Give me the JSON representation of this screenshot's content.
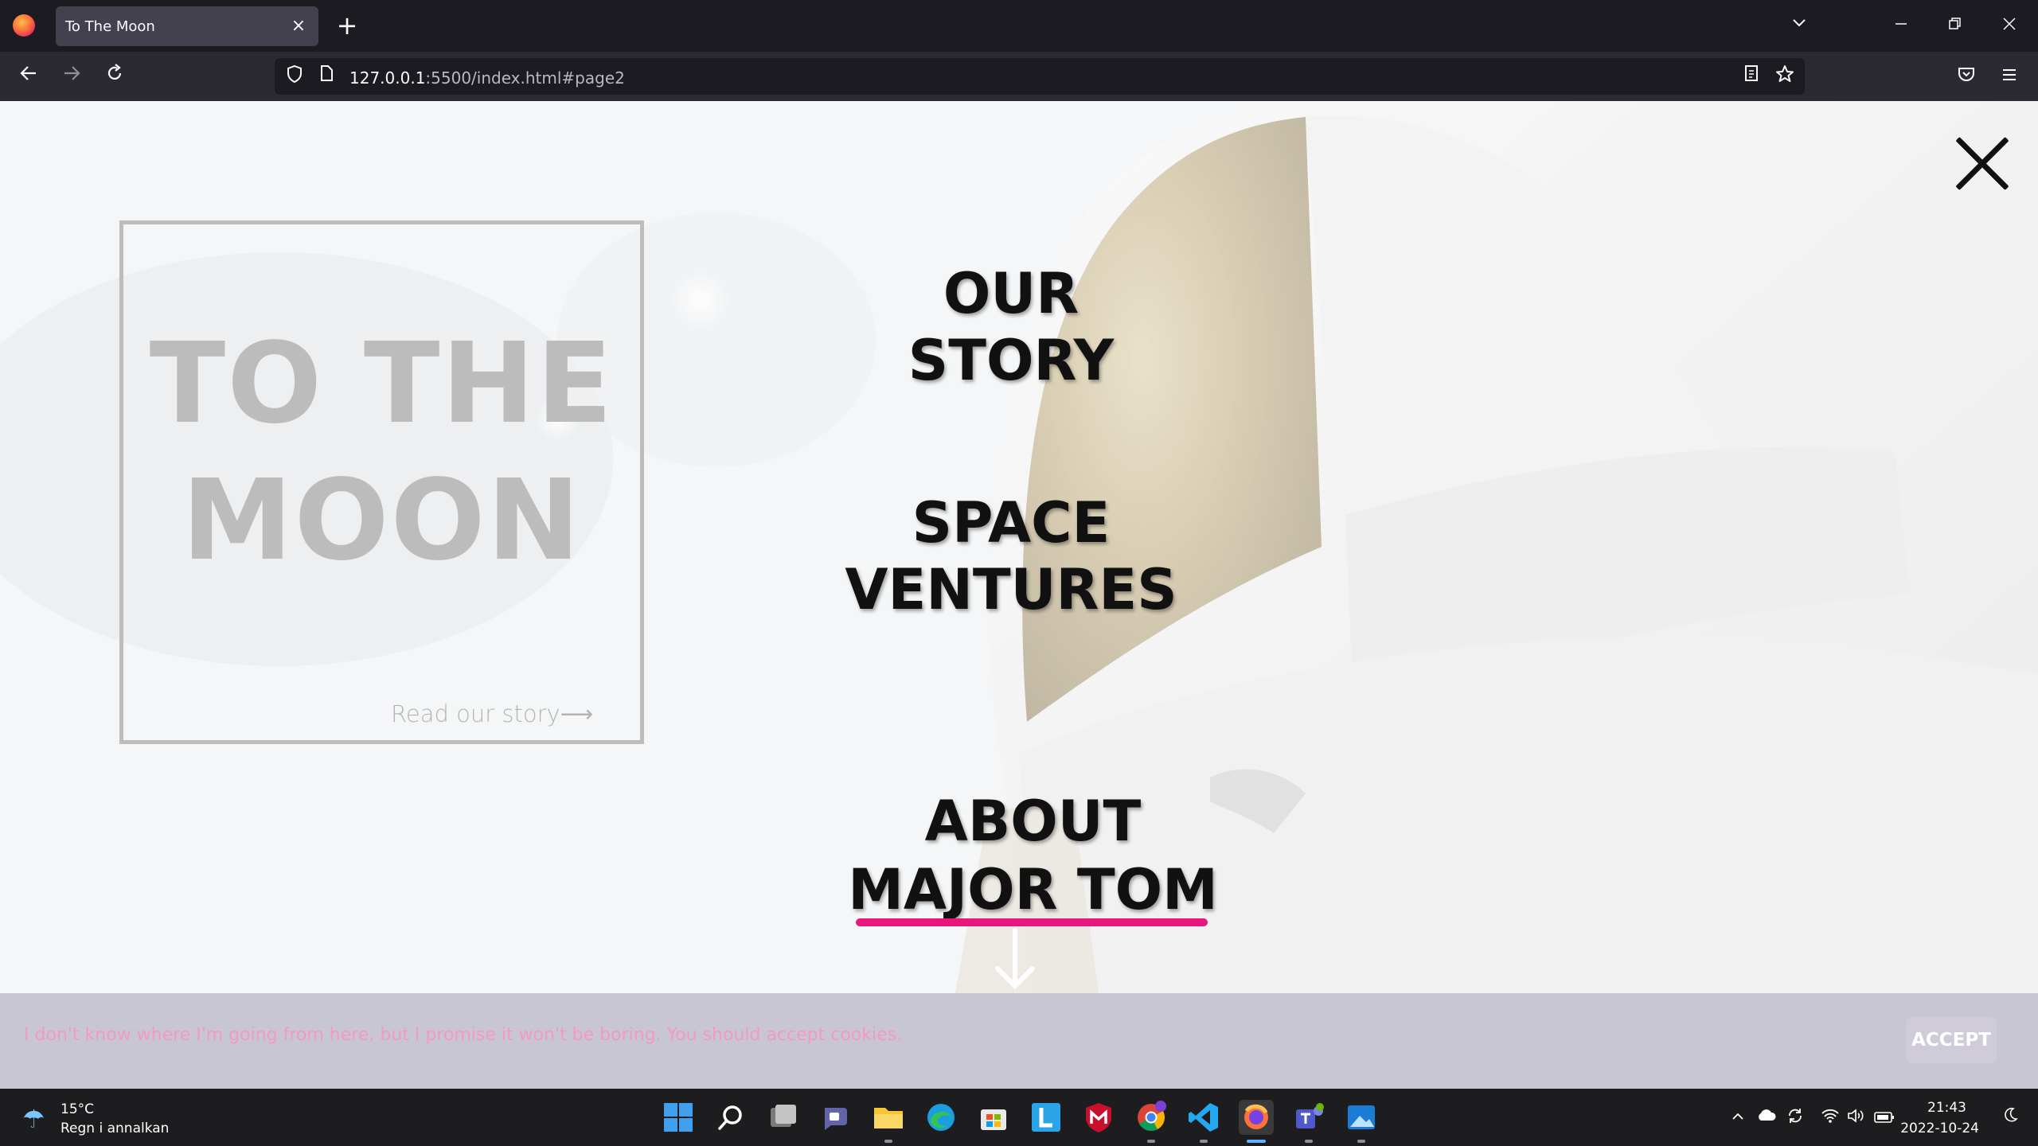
{
  "browser": {
    "tab_title": "To The Moon",
    "tab_close": "×",
    "new_tab": "+",
    "url_host": "127.0.0.1",
    "url_rest": ":5500/index.html#page2",
    "icons": [
      "firefox-icon",
      "back-icon",
      "forward-icon",
      "reload-icon",
      "shield-icon",
      "page-icon",
      "reader-icon",
      "bookmark-star-icon",
      "pocket-icon",
      "menu-icon",
      "tab-list-icon",
      "minimize-icon",
      "restore-icon",
      "close-window-icon"
    ]
  },
  "page": {
    "hero_title_line1": "TO THE",
    "hero_title_line2": "MOON",
    "hero_link": "Read our story⟶",
    "menu": {
      "our_story": "OUR STORY",
      "space_line1": "SPACE",
      "space_line2": "VENTURES",
      "about_line1": "ABOUT",
      "about_line2": "MAJOR TOM"
    },
    "accent_color": "#e8177d",
    "cookie_text": "I don't know where I'm going from here, but I promise it won't be boring. You should accept cookies.",
    "cookie_button": "ACCEPT"
  },
  "taskbar": {
    "weather_temp": "15°C",
    "weather_desc": "Regn i annalkan",
    "time": "21:43",
    "date": "2022-10-24",
    "apps": [
      "windows-start-icon",
      "search-icon",
      "task-view-icon",
      "chat-icon",
      "file-explorer-icon",
      "edge-icon",
      "store-icon",
      "l-app-icon",
      "mcafee-icon",
      "chrome-icon",
      "vscode-icon",
      "firefox-taskbar-icon",
      "teams-icon",
      "photos-icon"
    ]
  }
}
